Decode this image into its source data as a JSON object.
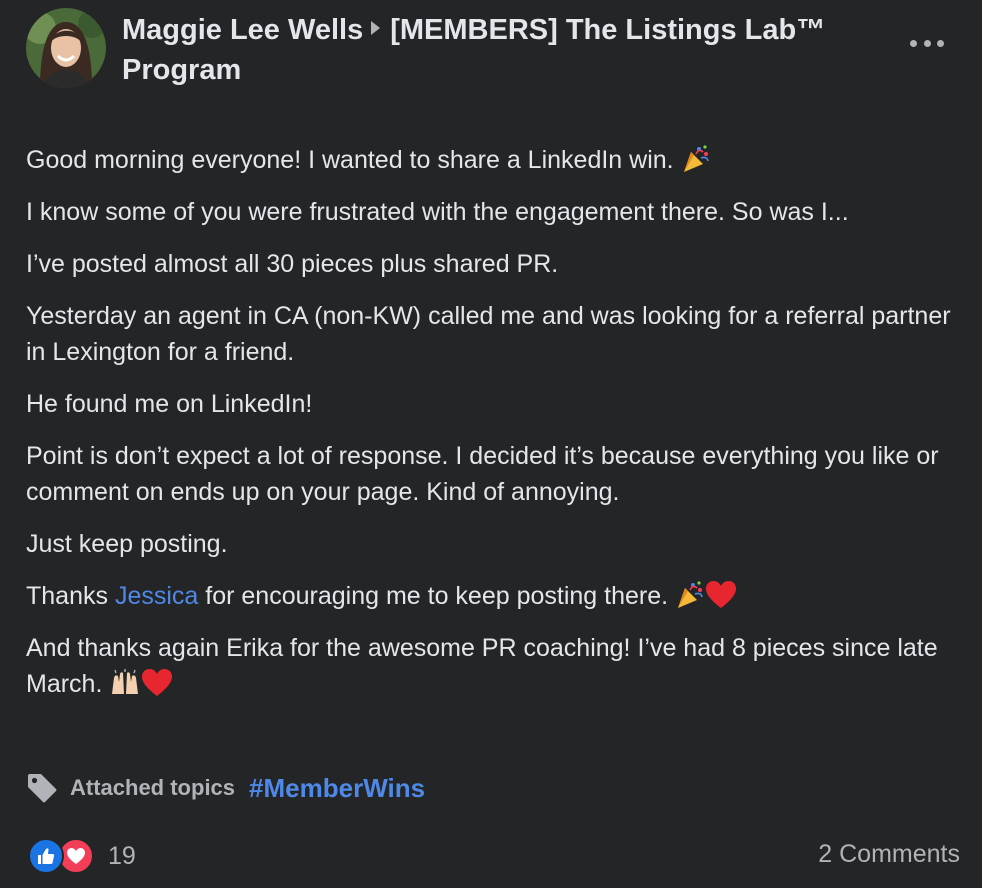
{
  "post": {
    "author": "Maggie Lee Wells",
    "group": "[MEMBERS] The Listings Lab™ Program",
    "paragraphs": {
      "p1": "Good morning everyone! I wanted to share a LinkedIn win.",
      "p2": "I know some of you were frustrated with the engagement there. So was I...",
      "p3": "I’ve posted almost all 30 pieces plus shared PR.",
      "p4": "Yesterday an agent in CA (non-KW) called me and was looking for a referral partner in Lexington for a friend.",
      "p5": "He found me on LinkedIn!",
      "p6": "Point is don’t expect a lot of response. I decided it’s because everything you like or comment on ends up on your page. Kind of annoying.",
      "p7": "Just keep posting.",
      "p8_before": "Thanks",
      "p8_mention": "Jessica",
      "p8_after": "for encouraging me to keep posting there.",
      "p9": "And thanks again Erika for the awesome PR coaching! I’ve had 8 pieces since late March."
    },
    "topics": {
      "label": "Attached topics",
      "hashtag": "#MemberWins"
    },
    "reactions": {
      "count": "19",
      "types": [
        "like-icon",
        "love-icon"
      ]
    },
    "comments": "2 Comments"
  },
  "colors": {
    "background": "#242526",
    "text": "#e4e6eb",
    "secondary": "#b0b3b8",
    "link": "#4e89e8",
    "like": "#1b74e4",
    "love": "#f33e58"
  }
}
